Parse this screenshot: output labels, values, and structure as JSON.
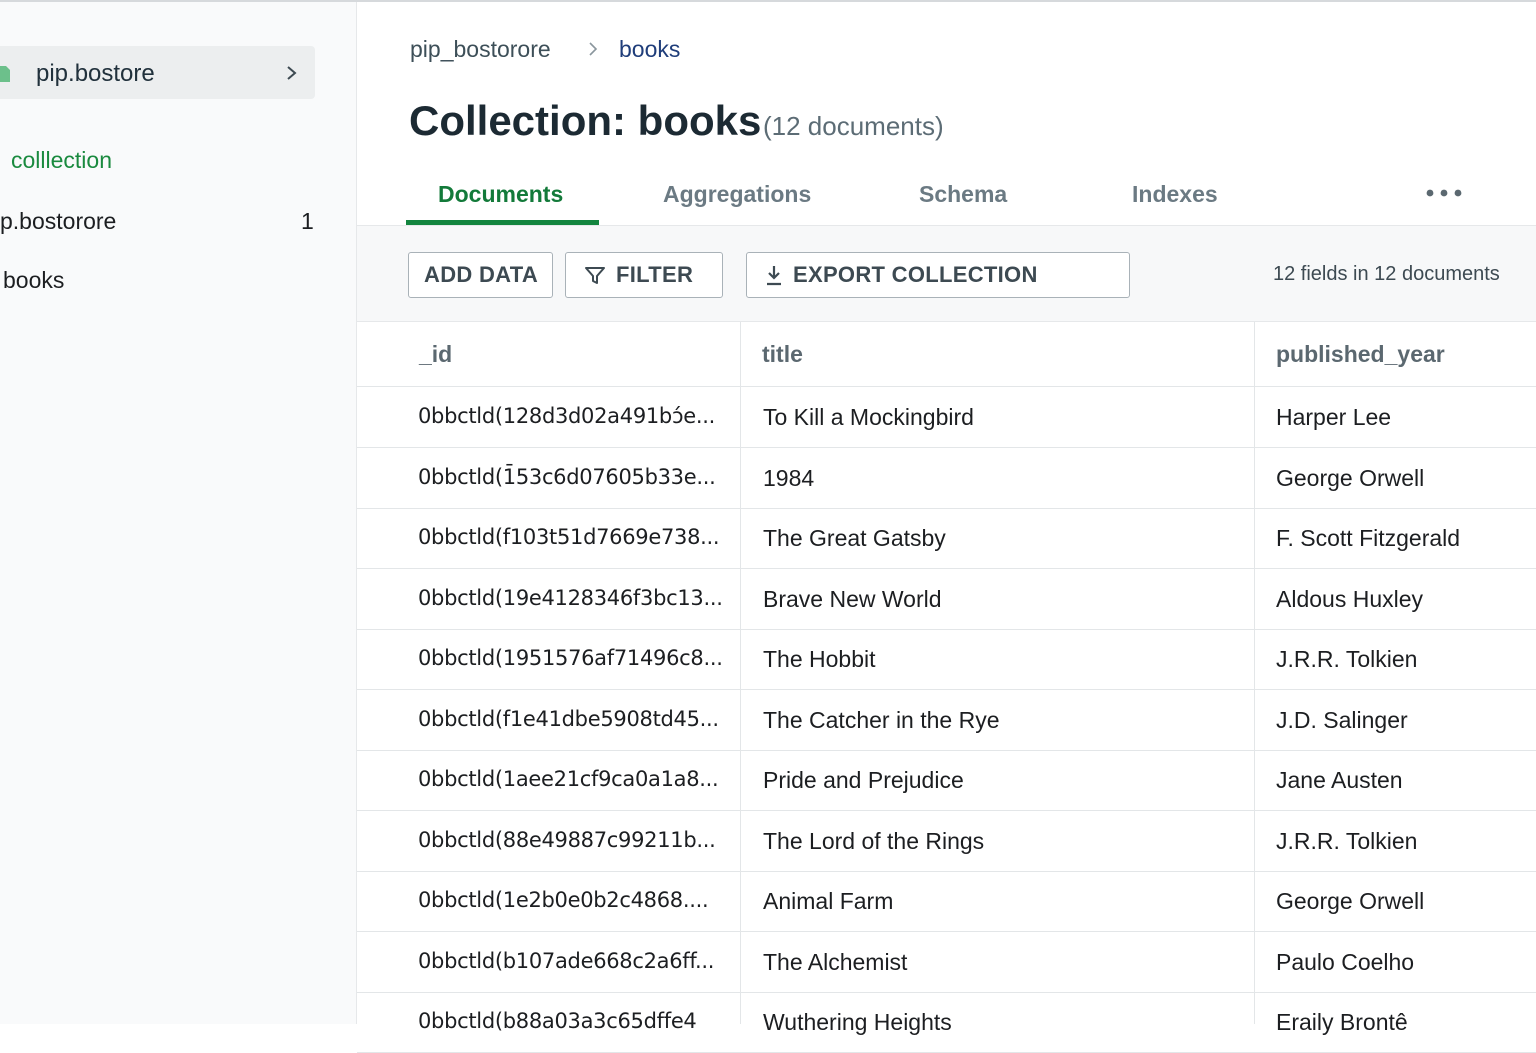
{
  "sidebar": {
    "database_name": "pip.bostore",
    "section_label": "colllection",
    "nav_database": "p.bostorore",
    "nav_database_count": "1",
    "nav_collection": "books"
  },
  "breadcrumb": {
    "database": "pip_bostorore",
    "collection": "books"
  },
  "header": {
    "title": "Collection: books",
    "subtitle": "(12 documents)"
  },
  "tabs": [
    "Documents",
    "Aggregations",
    "Schema",
    "Indexes"
  ],
  "active_tab": "Documents",
  "toolbar": {
    "add_label": "ADD DATA",
    "filter_label": "FILTER",
    "export_label": "EXPORT COLLECTION",
    "fields_info": "12 fields in 12 documents"
  },
  "table": {
    "columns": [
      "_id",
      "title",
      "published_year"
    ],
    "rows": [
      [
        "0bbctld(128d3d02a491bɔ́e...",
        "To Kill a Mockingbird",
        "Harper Lee"
      ],
      [
        "0bbctld(1̄53c6d07605b33e...",
        "1984",
        "George Orwell"
      ],
      [
        "0bbctld(f103t51d7669e738...",
        "The Great Gatsby",
        "F. Scott Fitzgerald"
      ],
      [
        "0bbctld(19e4128346f3bc13...",
        "Brave New World",
        "Aldous Huxley"
      ],
      [
        "0bbctld(1951576af71496c8...",
        "The Hobbit",
        "J.R.R. Tolkien"
      ],
      [
        "0bbctld(f1e41dbe5908td45...",
        "The Catcher in the Rye",
        "J.D. Salinger"
      ],
      [
        "0bbctld(1aee21c⁠f9ca0a1a8...",
        "Pride and Prejudice",
        "Jane Austen"
      ],
      [
        "0bbctld(88e49887c99211b...",
        "The Lord of the Rings",
        "J.R.R. Tolkien"
      ],
      [
        "0bbctld(1e2b0e0b2c4868....",
        "Animal Farm",
        "George Orwell"
      ],
      [
        "0bbctld(b107ade668c2a6ff...",
        "The Alchemist",
        "Paulo Coelho"
      ],
      [
        "0bbctld(b88a03a3c65dffe4",
        "Wuthering Heights",
        "Eraily Brontê"
      ]
    ]
  },
  "colors": {
    "accent_green": "#13853f",
    "breadcrumb_link": "#1f3d7a"
  }
}
